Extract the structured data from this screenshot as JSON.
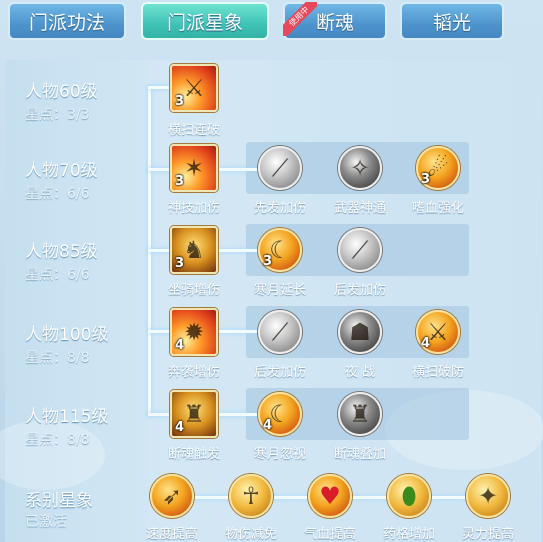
{
  "tabs": [
    {
      "label": "门派功法",
      "state": "inactive"
    },
    {
      "label": "门派星象",
      "state": "active"
    },
    {
      "label": "断魂",
      "state": "inactive",
      "ribbon": "使用中"
    },
    {
      "label": "韬光",
      "state": "inactive"
    }
  ],
  "rows": [
    {
      "level": "人物60级",
      "stars_label": "星点：",
      "stars": "3/3",
      "main": {
        "name": "横扫连破",
        "count": "3",
        "icon": "sweep-strike-icon"
      },
      "subs": []
    },
    {
      "level": "人物70级",
      "stars_label": "星点：",
      "stars": "6/6",
      "main": {
        "name": "神技加伤",
        "count": "3",
        "icon": "divine-skill-icon"
      },
      "subs": [
        {
          "name": "先发加伤",
          "count": "",
          "icon": "blade-silver-icon"
        },
        {
          "name": "武器神通",
          "count": "",
          "icon": "weapon-mastery-icon"
        },
        {
          "name": "嗜血强化",
          "count": "3",
          "icon": "bloodthirst-icon"
        }
      ]
    },
    {
      "level": "人物85级",
      "stars_label": "星点：",
      "stars": "6/6",
      "main": {
        "name": "坐骑增伤",
        "count": "3",
        "icon": "mount-beast-icon"
      },
      "subs": [
        {
          "name": "寒月延长",
          "count": "3",
          "icon": "cold-moon-icon"
        },
        {
          "name": "后发加伤",
          "count": "",
          "icon": "blade-silver-icon"
        }
      ]
    },
    {
      "level": "人物100级",
      "stars_label": "星点：",
      "stars": "8/8",
      "main": {
        "name": "奔袭增伤",
        "count": "4",
        "icon": "charge-flame-icon"
      },
      "subs": [
        {
          "name": "后发加伤",
          "count": "",
          "icon": "blade-silver-icon"
        },
        {
          "name": "夜 战",
          "count": "",
          "icon": "night-battle-icon"
        },
        {
          "name": "横扫破防",
          "count": "4",
          "icon": "sweep-break-icon"
        }
      ]
    },
    {
      "level": "人物115级",
      "stars_label": "星点：",
      "stars": "8/8",
      "main": {
        "name": "断魂触发",
        "count": "4",
        "icon": "soul-break-icon"
      },
      "subs": [
        {
          "name": "寒月忽视",
          "count": "4",
          "icon": "cold-moon-icon"
        },
        {
          "name": "断魂叠加",
          "count": "",
          "icon": "soul-stack-icon"
        }
      ]
    }
  ],
  "series": {
    "title": "系别星象",
    "status": "已激活",
    "items": [
      {
        "name": "速度提高",
        "icon": "speed-icon",
        "style": "orange"
      },
      {
        "name": "物伤减免",
        "icon": "physical-guard-icon",
        "style": "goldy"
      },
      {
        "name": "气血提高",
        "icon": "heart-icon",
        "style": "orange"
      },
      {
        "name": "药格增加",
        "icon": "medicine-icon",
        "style": "goldy"
      },
      {
        "name": "灵力提高",
        "icon": "spirit-icon",
        "style": "goldy"
      }
    ]
  }
}
